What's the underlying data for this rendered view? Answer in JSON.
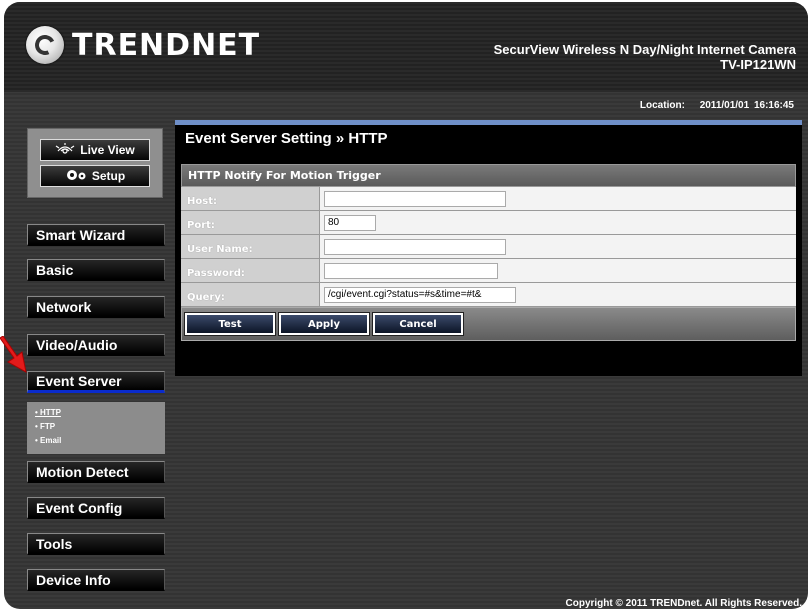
{
  "header": {
    "brand": "TRENDNET",
    "product_name": "SecurView Wireless N Day/Night Internet Camera",
    "model": "TV-IP121WN"
  },
  "location": {
    "label": "Location:",
    "datetime": "2011/01/01 16:16:45"
  },
  "view_buttons": {
    "live_view": "Live View",
    "setup": "Setup"
  },
  "menu": {
    "smart_wizard": "Smart Wizard",
    "basic": "Basic",
    "network": "Network",
    "video_audio": "Video/Audio",
    "event_server": "Event Server",
    "motion_detect": "Motion Detect",
    "event_config": "Event Config",
    "tools": "Tools",
    "device_info": "Device Info"
  },
  "submenu": [
    "• HTTP",
    "• FTP",
    "• Email"
  ],
  "page": {
    "title": "Event Server Setting » HTTP",
    "section": "HTTP Notify For Motion Trigger",
    "fields": {
      "host": {
        "label": "Host:",
        "value": ""
      },
      "port": {
        "label": "Port:",
        "value": "80"
      },
      "user": {
        "label": "User Name:",
        "value": ""
      },
      "password": {
        "label": "Password:",
        "value": ""
      },
      "query": {
        "label": "Query:",
        "value": "/cgi/event.cgi?status=#s&time=#t&"
      }
    },
    "buttons": {
      "test": "Test",
      "apply": "Apply",
      "cancel": "Cancel"
    }
  },
  "footer": {
    "copyright": "Copyright © 2011 TRENDnet. All Rights Reserved."
  },
  "colors": {
    "accent_blue": "#0a2bcc",
    "panel_top": "#6f8fc8",
    "annotation_arrow": "#e21b1b"
  }
}
